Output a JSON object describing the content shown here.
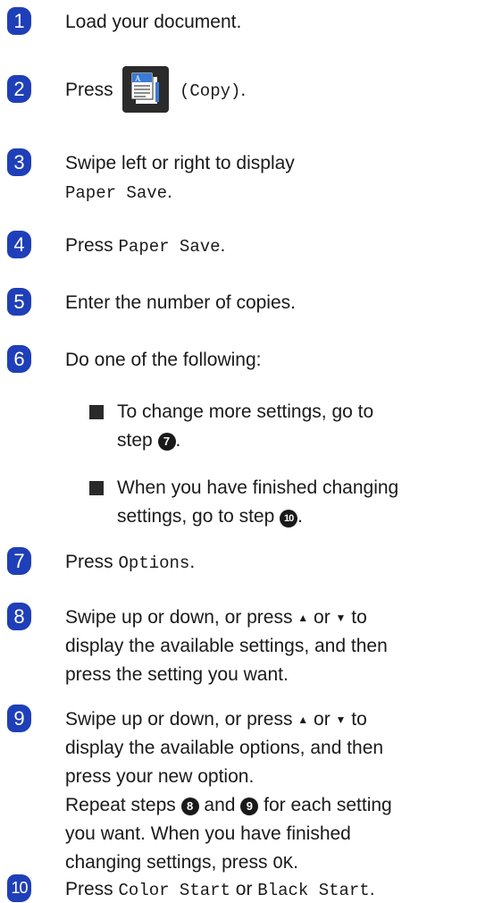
{
  "steps": [
    {
      "num": "1",
      "text": "Load your document."
    },
    {
      "num": "2",
      "pre": "Press",
      "post_mono": "(Copy)",
      "post_end": "."
    },
    {
      "num": "3",
      "line1": "Swipe left or right to display",
      "line2_mono": "Paper Save",
      "line2_end": "."
    },
    {
      "num": "4",
      "pre": "Press ",
      "mono": "Paper Save",
      "end": "."
    },
    {
      "num": "5",
      "text": "Enter the number of copies."
    },
    {
      "num": "6",
      "text": "Do one of the following:",
      "bullets": [
        {
          "line1": "To change more settings, go to",
          "line2_pre": "step ",
          "ref": "7",
          "line2_end": "."
        },
        {
          "line1": "When you have finished changing",
          "line2_pre": "settings, go to step ",
          "ref": "10",
          "line2_end": "."
        }
      ]
    },
    {
      "num": "7",
      "pre": "Press ",
      "mono": "Options",
      "end": "."
    },
    {
      "num": "8",
      "l1_a": "Swipe up or down, or press ",
      "l1_up": "▲",
      "l1_or": " or ",
      "l1_down": "▼",
      "l1_b": " to",
      "line2": "display the available settings, and then",
      "line3": "press the setting you want."
    },
    {
      "num": "9",
      "l1_a": "Swipe up or down, or press ",
      "l1_up": "▲",
      "l1_or": " or ",
      "l1_down": "▼",
      "l1_b": " to",
      "line2": "display the available options, and then",
      "line3": "press your new option.",
      "l4_a": "Repeat steps ",
      "ref_a": "8",
      "l4_and": " and ",
      "ref_b": "9",
      "l4_b": " for each setting",
      "line5": "you want. When you have finished",
      "l6_a": "changing settings, press ",
      "l6_mono": "OK",
      "l6_end": "."
    },
    {
      "num": "10",
      "pre": "Press ",
      "mono1": "Color Start",
      "or": " or ",
      "mono2": "Black Start",
      "end": "."
    }
  ],
  "icons": {
    "copy": "copy-icon"
  },
  "colors": {
    "badge": "#1f3fb8",
    "text": "#1a1a1a"
  }
}
